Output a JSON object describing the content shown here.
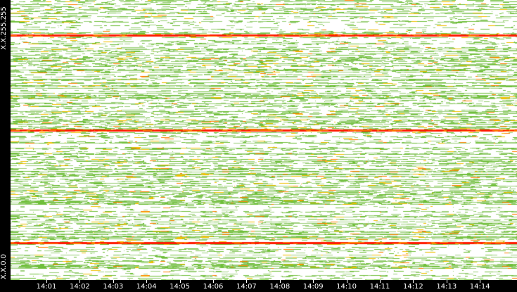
{
  "chart_data": {
    "type": "heatmap",
    "title": "",
    "xlabel": "",
    "ylabel": "",
    "x_tick_labels": [
      "14:01",
      "14:02",
      "14:03",
      "14:04",
      "14:05",
      "14:06",
      "14:07",
      "14:08",
      "14:09",
      "14:10",
      "14:11",
      "14:12",
      "14:13",
      "14:14"
    ],
    "x_range": [
      "14:00",
      "14:15"
    ],
    "y_tick_labels": {
      "top": "X.X.255.255",
      "bottom": "X.X.0.0"
    },
    "y_range": [
      "X.X.0.0",
      "X.X.255.255"
    ],
    "color_scale": [
      "#ffffff",
      "#9ccf7a",
      "#6fbf3a",
      "#f0c000",
      "#ff8000",
      "#ff1a00"
    ],
    "hot_rows": [
      {
        "position_fraction": 0.875,
        "intensity": 0.95
      },
      {
        "position_fraction": 0.535,
        "intensity": 1.0
      },
      {
        "position_fraction": 0.133,
        "intensity": 0.9
      }
    ],
    "background_density": 0.55,
    "grid": false
  }
}
